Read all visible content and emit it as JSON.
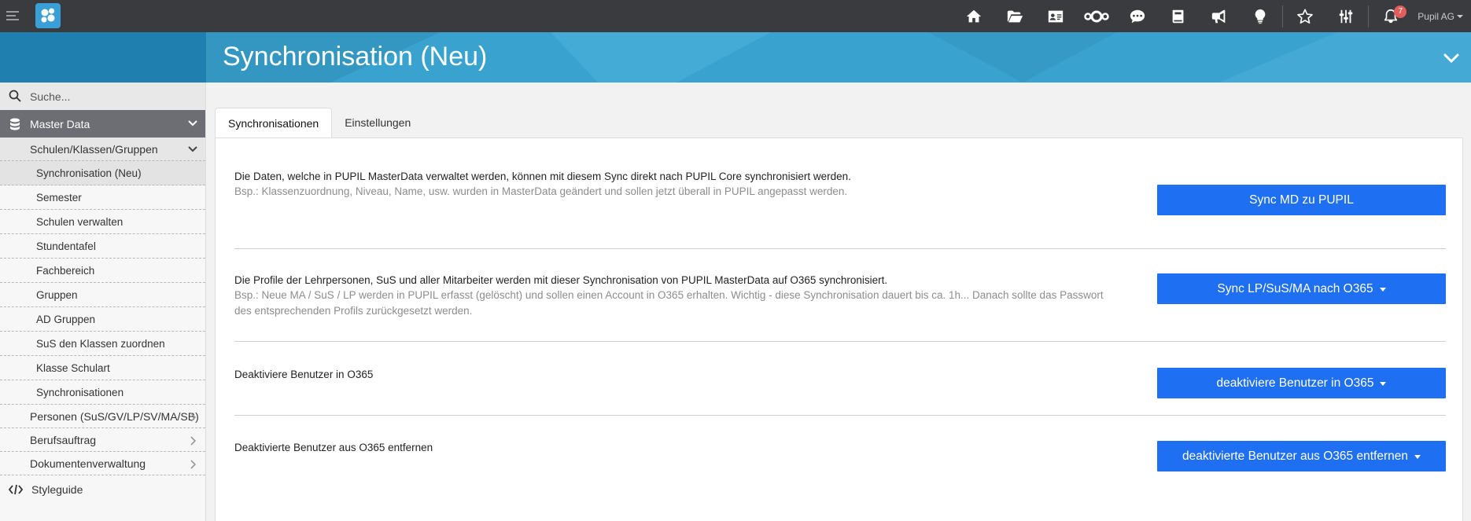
{
  "topbar": {
    "user": "Pupil AG",
    "notification_count": "7",
    "icons": [
      "home-icon",
      "folder-icon",
      "contact-card-icon",
      "nextcloud-icon",
      "chat-icon",
      "book-icon",
      "megaphone-icon",
      "lightbulb-icon",
      "star-icon",
      "sliders-icon",
      "bell-icon"
    ]
  },
  "header": {
    "title": "Synchronisation (Neu)"
  },
  "sidebar": {
    "search_placeholder": "Suche...",
    "section": "Master Data",
    "group_open": "Schulen/Klassen/Gruppen",
    "items": [
      "Synchronisation (Neu)",
      "Semester",
      "Schulen verwalten",
      "Stundentafel",
      "Fachbereich",
      "Gruppen",
      "AD Gruppen",
      "SuS den Klassen zuordnen",
      "Klasse Schulart",
      "Synchronisationen"
    ],
    "groups_closed": [
      "Personen (SuS/GV/LP/SV/MA/SB)",
      "Berufsauftrag",
      "Dokumentenverwaltung"
    ],
    "footer": "Styleguide"
  },
  "tabs": [
    "Synchronisationen",
    "Einstellungen"
  ],
  "sections": [
    {
      "title": "Die Daten, welche in PUPIL MasterData verwaltet werden, können mit diesem Sync direkt nach PUPIL Core synchronisiert werden.",
      "desc": "Bsp.: Klassenzuordnung, Niveau, Name, usw. wurden in MasterData geändert und sollen jetzt überall in PUPIL angepasst werden.",
      "button": "Sync MD zu PUPIL"
    },
    {
      "title": "Die Profile der Lehrpersonen, SuS und aller Mitarbeiter werden mit dieser Synchronisation von PUPIL MasterData auf O365 synchronisiert.",
      "desc": "Bsp.: Neue MA / SuS / LP werden in PUPIL erfasst (gelöscht) und sollen einen Account in O365 erhalten. Wichtig - diese Synchronisation dauert bis ca. 1h... Danach sollte das Passwort des entsprechenden Profils zurückgesetzt werden.",
      "button": "Sync LP/SuS/MA nach O365"
    },
    {
      "title": "Deaktiviere Benutzer in O365",
      "desc": "",
      "button": "deaktiviere Benutzer in O365"
    },
    {
      "title": "Deaktivierte Benutzer aus O365 entfernen",
      "desc": "",
      "button": "deaktivierte Benutzer aus O365 entfernen"
    }
  ]
}
